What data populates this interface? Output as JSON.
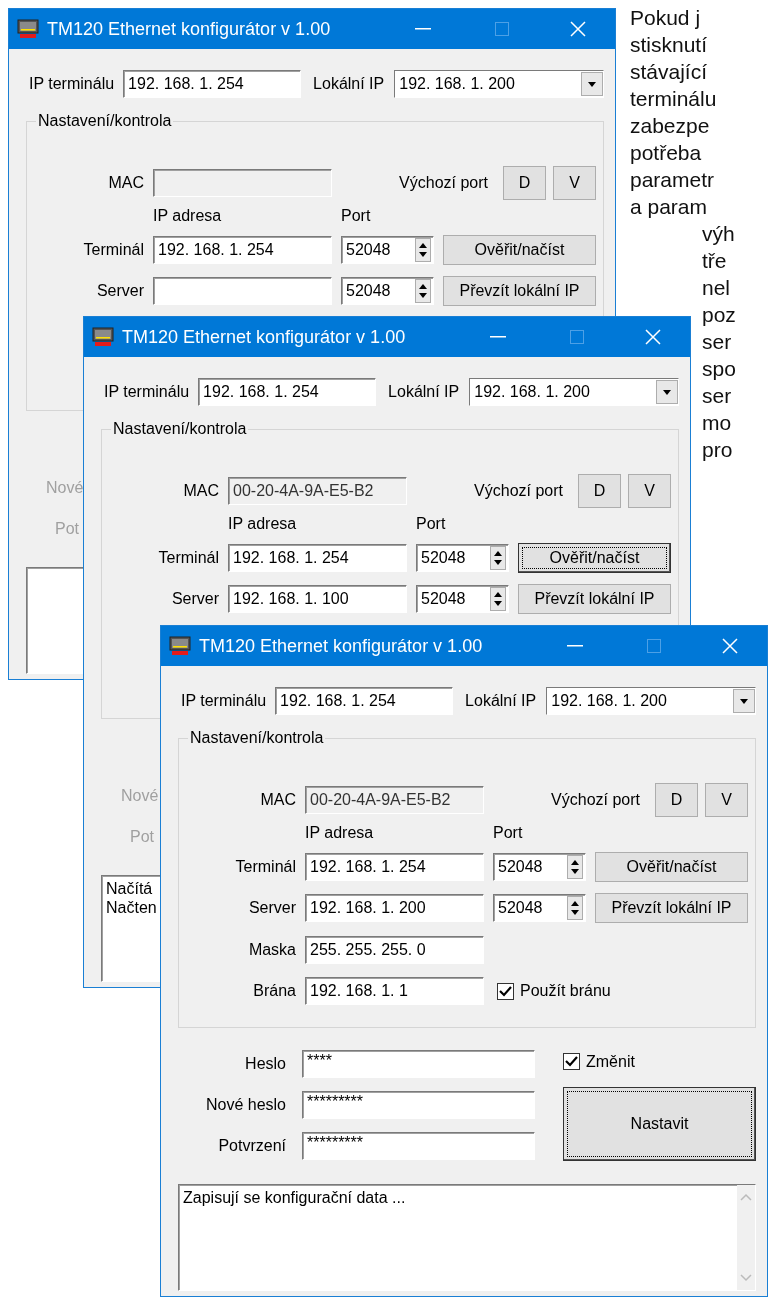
{
  "document_text": {
    "lines": [
      "Pokud j",
      "stisknutí",
      "stávající",
      "terminálu",
      "zabezpe",
      "potřeba",
      "parametr",
      "a param"
    ],
    "indented_lines": [
      "výh",
      "tře",
      "nel",
      "poz",
      "ser",
      "spo",
      "ser",
      "mo",
      "pro"
    ]
  },
  "windows": [
    {
      "title": "TM120 Ethernet konfigurátor v 1.00",
      "ip_terminal": {
        "label": "IP terminálu",
        "value": "192. 168. 1. 254"
      },
      "local_ip": {
        "label": "Lokální IP",
        "value": "192. 168. 1. 200"
      },
      "group": {
        "title": "Nastavení/kontrola",
        "mac": {
          "label": "MAC"
        },
        "default_port": {
          "label": "Výchozí port",
          "buttons": [
            "D",
            "V"
          ]
        },
        "col_ip": "IP adresa",
        "col_port": "Port",
        "rows": [
          {
            "label": "Terminál",
            "ip": "192. 168. 1. 254",
            "port": "52048",
            "button": "Ověřit/načíst",
            "focused": false
          },
          {
            "label": "Server",
            "port": "52048",
            "button": "Převzít lokální IP",
            "focused": false
          }
        ]
      },
      "passwords": [
        {
          "label": "Nové",
          "disabled": true
        },
        {
          "label": "Pot",
          "disabled": true
        }
      ]
    },
    {
      "title": "TM120 Ethernet konfigurátor v 1.00",
      "ip_terminal": {
        "label": "IP terminálu",
        "value": "192. 168. 1. 254"
      },
      "local_ip": {
        "label": "Lokální IP",
        "value": "192. 168. 1. 200"
      },
      "group": {
        "title": "Nastavení/kontrola",
        "mac": {
          "label": "MAC",
          "value": "00-20-4A-9A-E5-B2"
        },
        "default_port": {
          "label": "Výchozí port",
          "buttons": [
            "D",
            "V"
          ]
        },
        "col_ip": "IP adresa",
        "col_port": "Port",
        "rows": [
          {
            "label": "Terminál",
            "ip": "192. 168. 1. 254",
            "port": "52048",
            "button": "Ověřit/načíst",
            "focused": true
          },
          {
            "label": "Server",
            "ip": "192. 168. 1. 100",
            "port": "52048",
            "button": "Převzít lokální IP",
            "focused": false
          }
        ]
      },
      "passwords": [
        {
          "label": "Nové",
          "disabled": true
        },
        {
          "label": "Pot",
          "disabled": true
        }
      ],
      "log": {
        "lines": [
          "Načítá",
          "Načten"
        ]
      }
    },
    {
      "title": "TM120 Ethernet konfigurátor v 1.00",
      "ip_terminal": {
        "label": "IP terminálu",
        "value": "192. 168. 1. 254"
      },
      "local_ip": {
        "label": "Lokální IP",
        "value": "192. 168. 1. 200"
      },
      "group": {
        "title": "Nastavení/kontrola",
        "mac": {
          "label": "MAC",
          "value": "00-20-4A-9A-E5-B2"
        },
        "default_port": {
          "label": "Výchozí port",
          "buttons": [
            "D",
            "V"
          ]
        },
        "col_ip": "IP adresa",
        "col_port": "Port",
        "rows": [
          {
            "label": "Terminál",
            "ip": "192. 168. 1. 254",
            "port": "52048",
            "button": "Ověřit/načíst",
            "focused": false
          },
          {
            "label": "Server",
            "ip": "192. 168. 1. 200",
            "port": "52048",
            "button": "Převzít lokální IP",
            "focused": false
          }
        ],
        "mask": {
          "label": "Maska",
          "value": "255. 255. 255. 0"
        },
        "gateway": {
          "label": "Brána",
          "value": "192. 168. 1. 1",
          "checkbox": {
            "label": "Použít bránu",
            "checked": true
          }
        }
      },
      "passwords": [
        {
          "label": "Heslo",
          "value": "****",
          "disabled": false
        },
        {
          "label": "Nové heslo",
          "value": "*********",
          "disabled": false
        },
        {
          "label": "Potvrzení",
          "value": "*********",
          "disabled": false
        }
      ],
      "change": {
        "label": "Změnit",
        "checked": true
      },
      "set_button": {
        "label": "Nastavit",
        "focused": true
      },
      "log": {
        "lines": [
          "Zapisují se konfigurační data ..."
        ]
      }
    }
  ]
}
